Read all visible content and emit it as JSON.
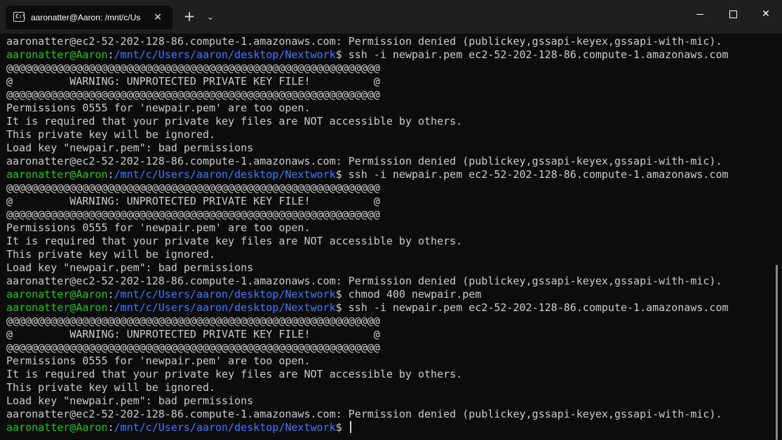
{
  "window": {
    "tab_title": "aaronatter@Aaron: /mnt/c/Us",
    "tab_icon": "terminal-icon",
    "tab_close": "✕",
    "new_tab": "+",
    "dropdown": "⌄",
    "close_label": "✕"
  },
  "terminal": {
    "lines": [
      {
        "text": "aaronatter@ec2-52-202-128-86.compute-1.amazonaws.com: Permission denied (publickey,gssapi-keyex,gssapi-with-mic)."
      },
      {
        "user": "aaronatter@Aaron",
        "sep": ":",
        "path": "/mnt/c/Users/aaron/desktop/Nextwork",
        "cmd": "$ ssh -i newpair.pem ec2-52-202-128-86.compute-1.amazonaws.com"
      },
      {
        "text": "@@@@@@@@@@@@@@@@@@@@@@@@@@@@@@@@@@@@@@@@@@@@@@@@@@@@@@@@@@@"
      },
      {
        "text": "@         WARNING: UNPROTECTED PRIVATE KEY FILE!          @"
      },
      {
        "text": "@@@@@@@@@@@@@@@@@@@@@@@@@@@@@@@@@@@@@@@@@@@@@@@@@@@@@@@@@@@"
      },
      {
        "text": "Permissions 0555 for 'newpair.pem' are too open."
      },
      {
        "text": "It is required that your private key files are NOT accessible by others."
      },
      {
        "text": "This private key will be ignored."
      },
      {
        "text": "Load key \"newpair.pem\": bad permissions"
      },
      {
        "text": "aaronatter@ec2-52-202-128-86.compute-1.amazonaws.com: Permission denied (publickey,gssapi-keyex,gssapi-with-mic)."
      },
      {
        "user": "aaronatter@Aaron",
        "sep": ":",
        "path": "/mnt/c/Users/aaron/desktop/Nextwork",
        "cmd": "$ ssh -i newpair.pem ec2-52-202-128-86.compute-1.amazonaws.com"
      },
      {
        "text": "@@@@@@@@@@@@@@@@@@@@@@@@@@@@@@@@@@@@@@@@@@@@@@@@@@@@@@@@@@@"
      },
      {
        "text": "@         WARNING: UNPROTECTED PRIVATE KEY FILE!          @"
      },
      {
        "text": "@@@@@@@@@@@@@@@@@@@@@@@@@@@@@@@@@@@@@@@@@@@@@@@@@@@@@@@@@@@"
      },
      {
        "text": "Permissions 0555 for 'newpair.pem' are too open."
      },
      {
        "text": "It is required that your private key files are NOT accessible by others."
      },
      {
        "text": "This private key will be ignored."
      },
      {
        "text": "Load key \"newpair.pem\": bad permissions"
      },
      {
        "text": "aaronatter@ec2-52-202-128-86.compute-1.amazonaws.com: Permission denied (publickey,gssapi-keyex,gssapi-with-mic)."
      },
      {
        "user": "aaronatter@Aaron",
        "sep": ":",
        "path": "/mnt/c/Users/aaron/desktop/Nextwork",
        "cmd": "$ chmod 400 newpair.pem"
      },
      {
        "user": "aaronatter@Aaron",
        "sep": ":",
        "path": "/mnt/c/Users/aaron/desktop/Nextwork",
        "cmd": "$ ssh -i newpair.pem ec2-52-202-128-86.compute-1.amazonaws.com"
      },
      {
        "text": "@@@@@@@@@@@@@@@@@@@@@@@@@@@@@@@@@@@@@@@@@@@@@@@@@@@@@@@@@@@"
      },
      {
        "text": "@         WARNING: UNPROTECTED PRIVATE KEY FILE!          @"
      },
      {
        "text": "@@@@@@@@@@@@@@@@@@@@@@@@@@@@@@@@@@@@@@@@@@@@@@@@@@@@@@@@@@@"
      },
      {
        "text": "Permissions 0555 for 'newpair.pem' are too open."
      },
      {
        "text": "It is required that your private key files are NOT accessible by others."
      },
      {
        "text": "This private key will be ignored."
      },
      {
        "text": "Load key \"newpair.pem\": bad permissions"
      },
      {
        "text": "aaronatter@ec2-52-202-128-86.compute-1.amazonaws.com: Permission denied (publickey,gssapi-keyex,gssapi-with-mic)."
      },
      {
        "user": "aaronatter@Aaron",
        "sep": ":",
        "path": "/mnt/c/Users/aaron/desktop/Nextwork",
        "cmd": "$ ",
        "cursor": true
      }
    ]
  },
  "colors": {
    "background": "#0c0c0c",
    "titlebar": "#1f1f1f",
    "text": "#cccccc",
    "user": "#16c60c",
    "path": "#3b78ff"
  }
}
